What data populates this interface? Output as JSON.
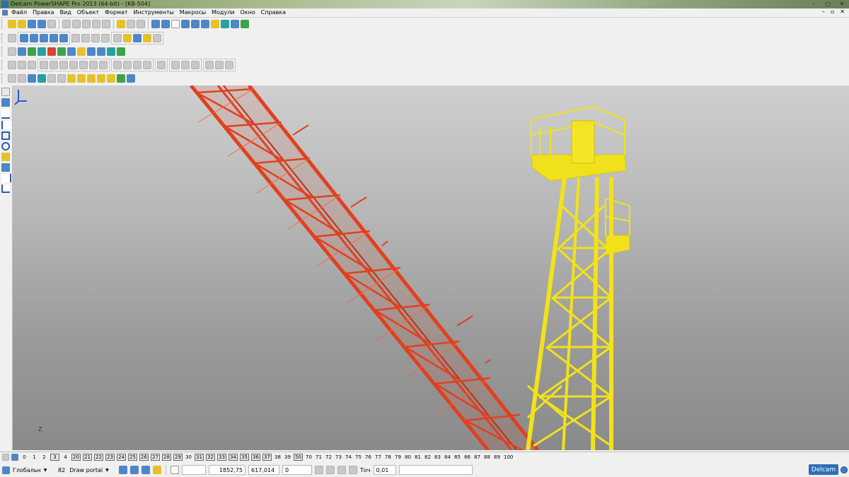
{
  "window": {
    "title": "Delcam PowerSHAPE Pro 2013 (64-bit) - [KB-504]",
    "controls": [
      "–",
      "□",
      "✕"
    ]
  },
  "menubar": {
    "items": [
      "Файл",
      "Правка",
      "Вид",
      "Объект",
      "Формат",
      "Инструменты",
      "Макросы",
      "Модули",
      "Окно",
      "Справка"
    ],
    "mdi_controls": [
      "–",
      "▫",
      "✕"
    ]
  },
  "levels": {
    "items": [
      "0",
      "1",
      "2",
      "3",
      "4",
      "20",
      "21",
      "22",
      "23",
      "24",
      "25",
      "26",
      "27",
      "28",
      "29",
      "30",
      "31",
      "32",
      "33",
      "34",
      "35",
      "36",
      "37",
      "38",
      "39",
      "50",
      "70",
      "71",
      "72",
      "73",
      "74",
      "75",
      "76",
      "77",
      "78",
      "79",
      "80",
      "81",
      "82",
      "83",
      "84",
      "85",
      "86",
      "87",
      "88",
      "89",
      "100"
    ],
    "boxed": [
      "3",
      "20",
      "21",
      "22",
      "23",
      "24",
      "25",
      "26",
      "27",
      "28",
      "29",
      "31",
      "32",
      "33",
      "34",
      "35",
      "36",
      "37",
      "50"
    ]
  },
  "status": {
    "workplane": "Глобальн",
    "level_number": "82",
    "level_name": "Draw portal",
    "coord_x": "1852,75",
    "coord_y": "617,014",
    "coord_z": "0",
    "tolerance_label": "Точ",
    "tolerance_value": "0,01"
  },
  "brand": {
    "label": "Delcam"
  },
  "colors": {
    "boom": "#e1401f",
    "tower": "#f2e21a",
    "viewport_top": "#cfcfcf",
    "viewport_bottom": "#8a8a8a"
  },
  "axis": {
    "label": "Z"
  }
}
